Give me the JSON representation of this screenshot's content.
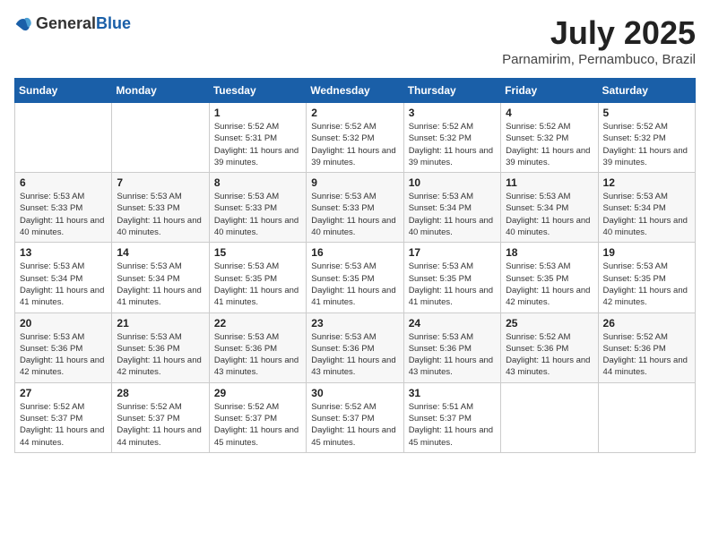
{
  "logo": {
    "general": "General",
    "blue": "Blue"
  },
  "title": "July 2025",
  "location": "Parnamirim, Pernambuco, Brazil",
  "weekdays": [
    "Sunday",
    "Monday",
    "Tuesday",
    "Wednesday",
    "Thursday",
    "Friday",
    "Saturday"
  ],
  "weeks": [
    [
      {
        "day": "",
        "sunrise": "",
        "sunset": "",
        "daylight": ""
      },
      {
        "day": "",
        "sunrise": "",
        "sunset": "",
        "daylight": ""
      },
      {
        "day": "1",
        "sunrise": "Sunrise: 5:52 AM",
        "sunset": "Sunset: 5:31 PM",
        "daylight": "Daylight: 11 hours and 39 minutes."
      },
      {
        "day": "2",
        "sunrise": "Sunrise: 5:52 AM",
        "sunset": "Sunset: 5:32 PM",
        "daylight": "Daylight: 11 hours and 39 minutes."
      },
      {
        "day": "3",
        "sunrise": "Sunrise: 5:52 AM",
        "sunset": "Sunset: 5:32 PM",
        "daylight": "Daylight: 11 hours and 39 minutes."
      },
      {
        "day": "4",
        "sunrise": "Sunrise: 5:52 AM",
        "sunset": "Sunset: 5:32 PM",
        "daylight": "Daylight: 11 hours and 39 minutes."
      },
      {
        "day": "5",
        "sunrise": "Sunrise: 5:52 AM",
        "sunset": "Sunset: 5:32 PM",
        "daylight": "Daylight: 11 hours and 39 minutes."
      }
    ],
    [
      {
        "day": "6",
        "sunrise": "Sunrise: 5:53 AM",
        "sunset": "Sunset: 5:33 PM",
        "daylight": "Daylight: 11 hours and 40 minutes."
      },
      {
        "day": "7",
        "sunrise": "Sunrise: 5:53 AM",
        "sunset": "Sunset: 5:33 PM",
        "daylight": "Daylight: 11 hours and 40 minutes."
      },
      {
        "day": "8",
        "sunrise": "Sunrise: 5:53 AM",
        "sunset": "Sunset: 5:33 PM",
        "daylight": "Daylight: 11 hours and 40 minutes."
      },
      {
        "day": "9",
        "sunrise": "Sunrise: 5:53 AM",
        "sunset": "Sunset: 5:33 PM",
        "daylight": "Daylight: 11 hours and 40 minutes."
      },
      {
        "day": "10",
        "sunrise": "Sunrise: 5:53 AM",
        "sunset": "Sunset: 5:34 PM",
        "daylight": "Daylight: 11 hours and 40 minutes."
      },
      {
        "day": "11",
        "sunrise": "Sunrise: 5:53 AM",
        "sunset": "Sunset: 5:34 PM",
        "daylight": "Daylight: 11 hours and 40 minutes."
      },
      {
        "day": "12",
        "sunrise": "Sunrise: 5:53 AM",
        "sunset": "Sunset: 5:34 PM",
        "daylight": "Daylight: 11 hours and 40 minutes."
      }
    ],
    [
      {
        "day": "13",
        "sunrise": "Sunrise: 5:53 AM",
        "sunset": "Sunset: 5:34 PM",
        "daylight": "Daylight: 11 hours and 41 minutes."
      },
      {
        "day": "14",
        "sunrise": "Sunrise: 5:53 AM",
        "sunset": "Sunset: 5:34 PM",
        "daylight": "Daylight: 11 hours and 41 minutes."
      },
      {
        "day": "15",
        "sunrise": "Sunrise: 5:53 AM",
        "sunset": "Sunset: 5:35 PM",
        "daylight": "Daylight: 11 hours and 41 minutes."
      },
      {
        "day": "16",
        "sunrise": "Sunrise: 5:53 AM",
        "sunset": "Sunset: 5:35 PM",
        "daylight": "Daylight: 11 hours and 41 minutes."
      },
      {
        "day": "17",
        "sunrise": "Sunrise: 5:53 AM",
        "sunset": "Sunset: 5:35 PM",
        "daylight": "Daylight: 11 hours and 41 minutes."
      },
      {
        "day": "18",
        "sunrise": "Sunrise: 5:53 AM",
        "sunset": "Sunset: 5:35 PM",
        "daylight": "Daylight: 11 hours and 42 minutes."
      },
      {
        "day": "19",
        "sunrise": "Sunrise: 5:53 AM",
        "sunset": "Sunset: 5:35 PM",
        "daylight": "Daylight: 11 hours and 42 minutes."
      }
    ],
    [
      {
        "day": "20",
        "sunrise": "Sunrise: 5:53 AM",
        "sunset": "Sunset: 5:36 PM",
        "daylight": "Daylight: 11 hours and 42 minutes."
      },
      {
        "day": "21",
        "sunrise": "Sunrise: 5:53 AM",
        "sunset": "Sunset: 5:36 PM",
        "daylight": "Daylight: 11 hours and 42 minutes."
      },
      {
        "day": "22",
        "sunrise": "Sunrise: 5:53 AM",
        "sunset": "Sunset: 5:36 PM",
        "daylight": "Daylight: 11 hours and 43 minutes."
      },
      {
        "day": "23",
        "sunrise": "Sunrise: 5:53 AM",
        "sunset": "Sunset: 5:36 PM",
        "daylight": "Daylight: 11 hours and 43 minutes."
      },
      {
        "day": "24",
        "sunrise": "Sunrise: 5:53 AM",
        "sunset": "Sunset: 5:36 PM",
        "daylight": "Daylight: 11 hours and 43 minutes."
      },
      {
        "day": "25",
        "sunrise": "Sunrise: 5:52 AM",
        "sunset": "Sunset: 5:36 PM",
        "daylight": "Daylight: 11 hours and 43 minutes."
      },
      {
        "day": "26",
        "sunrise": "Sunrise: 5:52 AM",
        "sunset": "Sunset: 5:36 PM",
        "daylight": "Daylight: 11 hours and 44 minutes."
      }
    ],
    [
      {
        "day": "27",
        "sunrise": "Sunrise: 5:52 AM",
        "sunset": "Sunset: 5:37 PM",
        "daylight": "Daylight: 11 hours and 44 minutes."
      },
      {
        "day": "28",
        "sunrise": "Sunrise: 5:52 AM",
        "sunset": "Sunset: 5:37 PM",
        "daylight": "Daylight: 11 hours and 44 minutes."
      },
      {
        "day": "29",
        "sunrise": "Sunrise: 5:52 AM",
        "sunset": "Sunset: 5:37 PM",
        "daylight": "Daylight: 11 hours and 45 minutes."
      },
      {
        "day": "30",
        "sunrise": "Sunrise: 5:52 AM",
        "sunset": "Sunset: 5:37 PM",
        "daylight": "Daylight: 11 hours and 45 minutes."
      },
      {
        "day": "31",
        "sunrise": "Sunrise: 5:51 AM",
        "sunset": "Sunset: 5:37 PM",
        "daylight": "Daylight: 11 hours and 45 minutes."
      },
      {
        "day": "",
        "sunrise": "",
        "sunset": "",
        "daylight": ""
      },
      {
        "day": "",
        "sunrise": "",
        "sunset": "",
        "daylight": ""
      }
    ]
  ]
}
